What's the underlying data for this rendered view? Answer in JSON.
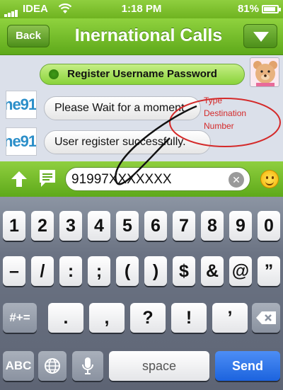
{
  "status_bar": {
    "carrier": "IDEA",
    "time": "1:18 PM",
    "battery": "81%",
    "signal_bars": 4,
    "battery_level": 0.81
  },
  "nav": {
    "back_label": "Back",
    "title": "Inernational Calls",
    "menu_icon": "chevron-down-icon"
  },
  "chat": {
    "messages": [
      {
        "text": "Register Username Password",
        "from": "user",
        "avatar": "bear-avatar"
      },
      {
        "text": "Please Wait for a moment",
        "from": "app",
        "avatar": "ne91"
      },
      {
        "text": "User register successfully.",
        "from": "app",
        "avatar": "ne91"
      }
    ],
    "logo_text": "ne91"
  },
  "annotation": {
    "lines": [
      "Type",
      "Destination",
      "Number"
    ],
    "color": "#d42a2a"
  },
  "composer": {
    "value": "91997XXXXXXX",
    "up_icon": "arrow-up-icon",
    "message_icon": "message-icon",
    "clear_icon": "clear-icon",
    "emoji_icon": "smiley-icon"
  },
  "keyboard": {
    "row1": [
      "1",
      "2",
      "3",
      "4",
      "5",
      "6",
      "7",
      "8",
      "9",
      "0"
    ],
    "row2": [
      "–",
      "/",
      ":",
      ";",
      "(",
      ")",
      "$",
      "&",
      "@",
      "”"
    ],
    "row3_left": "#+=",
    "row3": [
      ".",
      ",",
      "?",
      "!",
      "’"
    ],
    "abc": "ABC",
    "space": "space",
    "send": "Send",
    "globe_icon": "globe-icon",
    "mic_icon": "microphone-icon",
    "backspace_icon": "backspace-icon",
    "send_color": "#1c63de"
  }
}
